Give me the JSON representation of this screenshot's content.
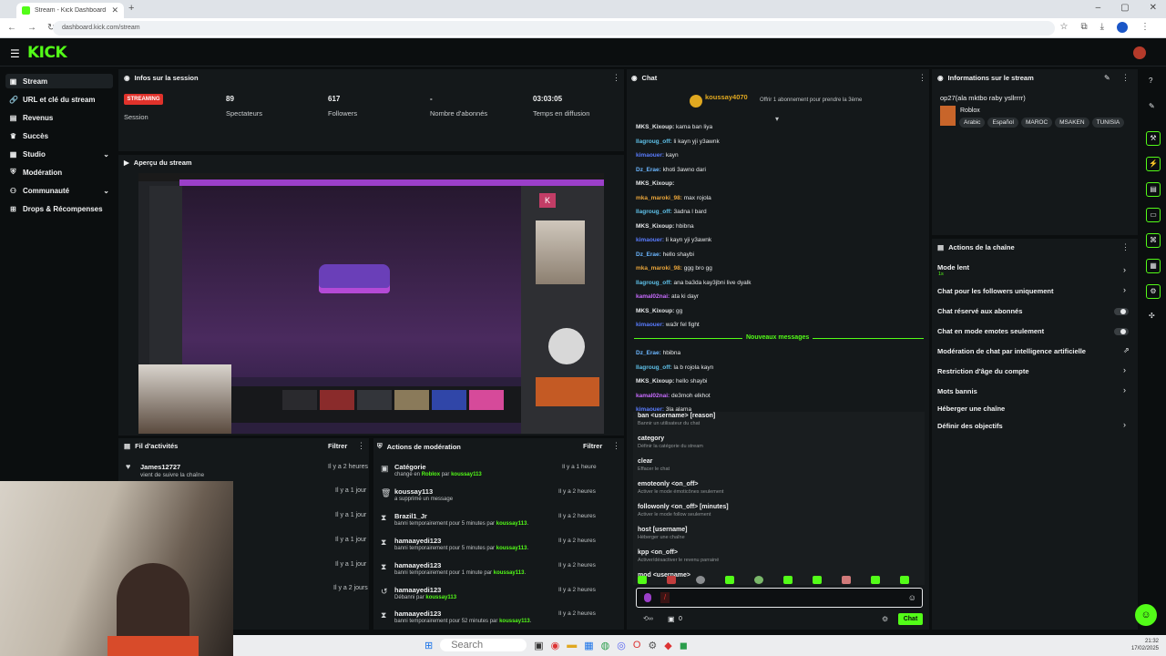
{
  "browser": {
    "tab_title": "Stream - Kick Dashboard",
    "url": "dashboard.kick.com/stream"
  },
  "header": {
    "logo": "KICK"
  },
  "sidebar": {
    "items": [
      {
        "label": "Stream"
      },
      {
        "label": "URL et clé du stream"
      },
      {
        "label": "Revenus"
      },
      {
        "label": "Succès"
      },
      {
        "label": "Studio"
      },
      {
        "label": "Modération"
      },
      {
        "label": "Communauté"
      },
      {
        "label": "Drops & Récompenses"
      }
    ]
  },
  "session": {
    "title": "Infos sur la session",
    "badge": "STREAMING",
    "badge_label": "Session",
    "viewers_value": "89",
    "viewers_label": "Spectateurs",
    "followers_value": "617",
    "followers_label": "Followers",
    "subs_value": "-",
    "subs_label": "Nombre d'abonnés",
    "time_value": "03:03:05",
    "time_label": "Temps en diffusion"
  },
  "preview": {
    "title": "Aperçu du stream"
  },
  "activity": {
    "title": "Fil d'activités",
    "filter": "Filtrer",
    "items": [
      {
        "name": "James12727",
        "sub": "vient de suivre la chaîne",
        "time": "Il y a 2 heures"
      },
      {
        "time": "Il y a 1 jour"
      },
      {
        "time": "Il y a 1 jour"
      },
      {
        "time": "Il y a 1 jour"
      },
      {
        "time": "Il y a 1 jour"
      },
      {
        "time": "Il y a 2 jours"
      }
    ]
  },
  "moderation": {
    "title": "Actions de modération",
    "filter": "Filtrer",
    "items": [
      {
        "name": "Catégorie",
        "pre": "changé en ",
        "hl1": "Roblox",
        "mid": " par ",
        "hl2": "koussay113",
        "post": "",
        "time": "Il y a 1 heure"
      },
      {
        "name": "koussay113",
        "pre": "a supprimé un message",
        "hl1": "",
        "mid": "",
        "hl2": "",
        "post": "",
        "time": "Il y a 2 heures"
      },
      {
        "name": "Brazil1_Jr",
        "pre": "banni temporairement pour 5 minutes par ",
        "hl1": "",
        "mid": "",
        "hl2": "koussay113",
        "post": ".",
        "time": "Il y a 2 heures"
      },
      {
        "name": "hamaayedi123",
        "pre": "banni temporairement pour 5 minutes par ",
        "hl1": "",
        "mid": "",
        "hl2": "koussay113",
        "post": ".",
        "time": "Il y a 2 heures"
      },
      {
        "name": "hamaayedi123",
        "pre": "banni temporairement pour 1 minute par ",
        "hl1": "",
        "mid": "",
        "hl2": "koussay113",
        "post": ".",
        "time": "Il y a 2 heures"
      },
      {
        "name": "hamaayedi123",
        "pre": "Débanni par ",
        "hl1": "",
        "mid": "",
        "hl2": "koussay113",
        "post": "",
        "time": "Il y a 2 heures"
      },
      {
        "name": "hamaayedi123",
        "pre": "banni temporairement pour 52 minutes par ",
        "hl1": "",
        "mid": "",
        "hl2": "koussay113",
        "post": ".",
        "time": "Il y a 2 heures"
      }
    ]
  },
  "chat": {
    "title": "Chat",
    "pinned_user": "koussay4070",
    "pinned_text": "Offrir 1 abonnement pour prendre la 3ème",
    "new_messages_label": "Nouveaux messages",
    "messages": [
      {
        "user": "MKS_Kixoup:",
        "color": "#e6e8ea",
        "text": " kama ban liya"
      },
      {
        "user": "Ilagroug_off:",
        "color": "#5ec0e8",
        "text": " li kayn yji y3awnk"
      },
      {
        "user": "kimaouer:",
        "color": "#5a7cff",
        "text": " kayn"
      },
      {
        "user": "Dz_Erae:",
        "color": "#6bb6ff",
        "text": " khoti 3awno dari"
      },
      {
        "user": "MKS_Kixoup:",
        "color": "#e6e8ea",
        "text": ""
      },
      {
        "user": "mka_maroki_98:",
        "color": "#e8a43a",
        "text": " max rojola"
      },
      {
        "user": "Ilagroug_off:",
        "color": "#5ec0e8",
        "text": " 3adna l bard"
      },
      {
        "user": "MKS_Kixoup:",
        "color": "#e6e8ea",
        "text": " hbibna"
      },
      {
        "user": "kimaouer:",
        "color": "#5a7cff",
        "text": " li kayn yji y3awnk"
      },
      {
        "user": "Dz_Erae:",
        "color": "#6bb6ff",
        "text": " hello shaybi"
      },
      {
        "user": "mka_maroki_98:",
        "color": "#e8a43a",
        "text": " ggg bro gg"
      },
      {
        "user": "Ilagroug_off:",
        "color": "#5ec0e8",
        "text": " ana ba3da kay3jbni live dyalk"
      },
      {
        "user": "kamal02nai:",
        "color": "#c86bff",
        "text": " ata ki dayr"
      },
      {
        "user": "MKS_Kixoup:",
        "color": "#e6e8ea",
        "text": " gg"
      },
      {
        "user": "kimaouer:",
        "color": "#5a7cff",
        "text": " wa3r fel fight"
      }
    ],
    "new_messages": [
      {
        "user": "Dz_Erae:",
        "color": "#6bb6ff",
        "text": " hbibna"
      },
      {
        "user": "Ilagroug_off:",
        "color": "#5ec0e8",
        "text": " la b rojola kayn"
      },
      {
        "user": "MKS_Kixoup:",
        "color": "#e6e8ea",
        "text": " hello shaybi"
      },
      {
        "user": "kamal02nai:",
        "color": "#c86bff",
        "text": " de3moh elkhot"
      },
      {
        "user": "kimaouer:",
        "color": "#5a7cff",
        "text": " 3la alama"
      }
    ],
    "commands": [
      {
        "name": "ban <username> [reason]",
        "desc": "Bannir un utilisateur du chat"
      },
      {
        "name": "category",
        "desc": "Définir la catégorie du stream"
      },
      {
        "name": "clear",
        "desc": "Effacer le chat"
      },
      {
        "name": "emoteonly <on_off>",
        "desc": "Activer le mode émoticônes seulement"
      },
      {
        "name": "followonly <on_off> [minutes]",
        "desc": "Activer le mode follow seulement"
      },
      {
        "name": "host [username]",
        "desc": "Héberger une chaîne"
      },
      {
        "name": "kpp <on_off>",
        "desc": "Activer/désactiver le revenu parrainé"
      },
      {
        "name": "mod <username>",
        "desc": ""
      }
    ],
    "input_value": "/",
    "count": "0",
    "send_label": "Chat"
  },
  "stream_info": {
    "title": "Informations sur le stream",
    "stream_title": "op27(ala mktbo raby ysllrrrr)",
    "category": "Roblox",
    "tags": [
      "Arabic",
      "Español",
      "MAROC",
      "MSAKEN",
      "TUNISIA"
    ]
  },
  "channel_actions": {
    "title": "Actions de la chaîne",
    "items": [
      {
        "label": "Mode lent",
        "sub": "1s"
      },
      {
        "label": "Chat pour les followers uniquement"
      },
      {
        "label": "Chat réservé aux abonnés"
      },
      {
        "label": "Chat en mode emotes seulement"
      },
      {
        "label": "Modération de chat par intelligence artificielle"
      },
      {
        "label": "Restriction d'âge du compte"
      },
      {
        "label": "Mots bannis"
      },
      {
        "label": "Héberger une chaîne"
      },
      {
        "label": "Définir des objectifs"
      }
    ]
  },
  "taskbar": {
    "search_placeholder": "Search",
    "time": "21:32",
    "date": "17/02/2025"
  },
  "colors": {
    "accent": "#53fc18",
    "live": "#e0322b",
    "panel": "#14181a",
    "bg": "#0b0e0f"
  }
}
